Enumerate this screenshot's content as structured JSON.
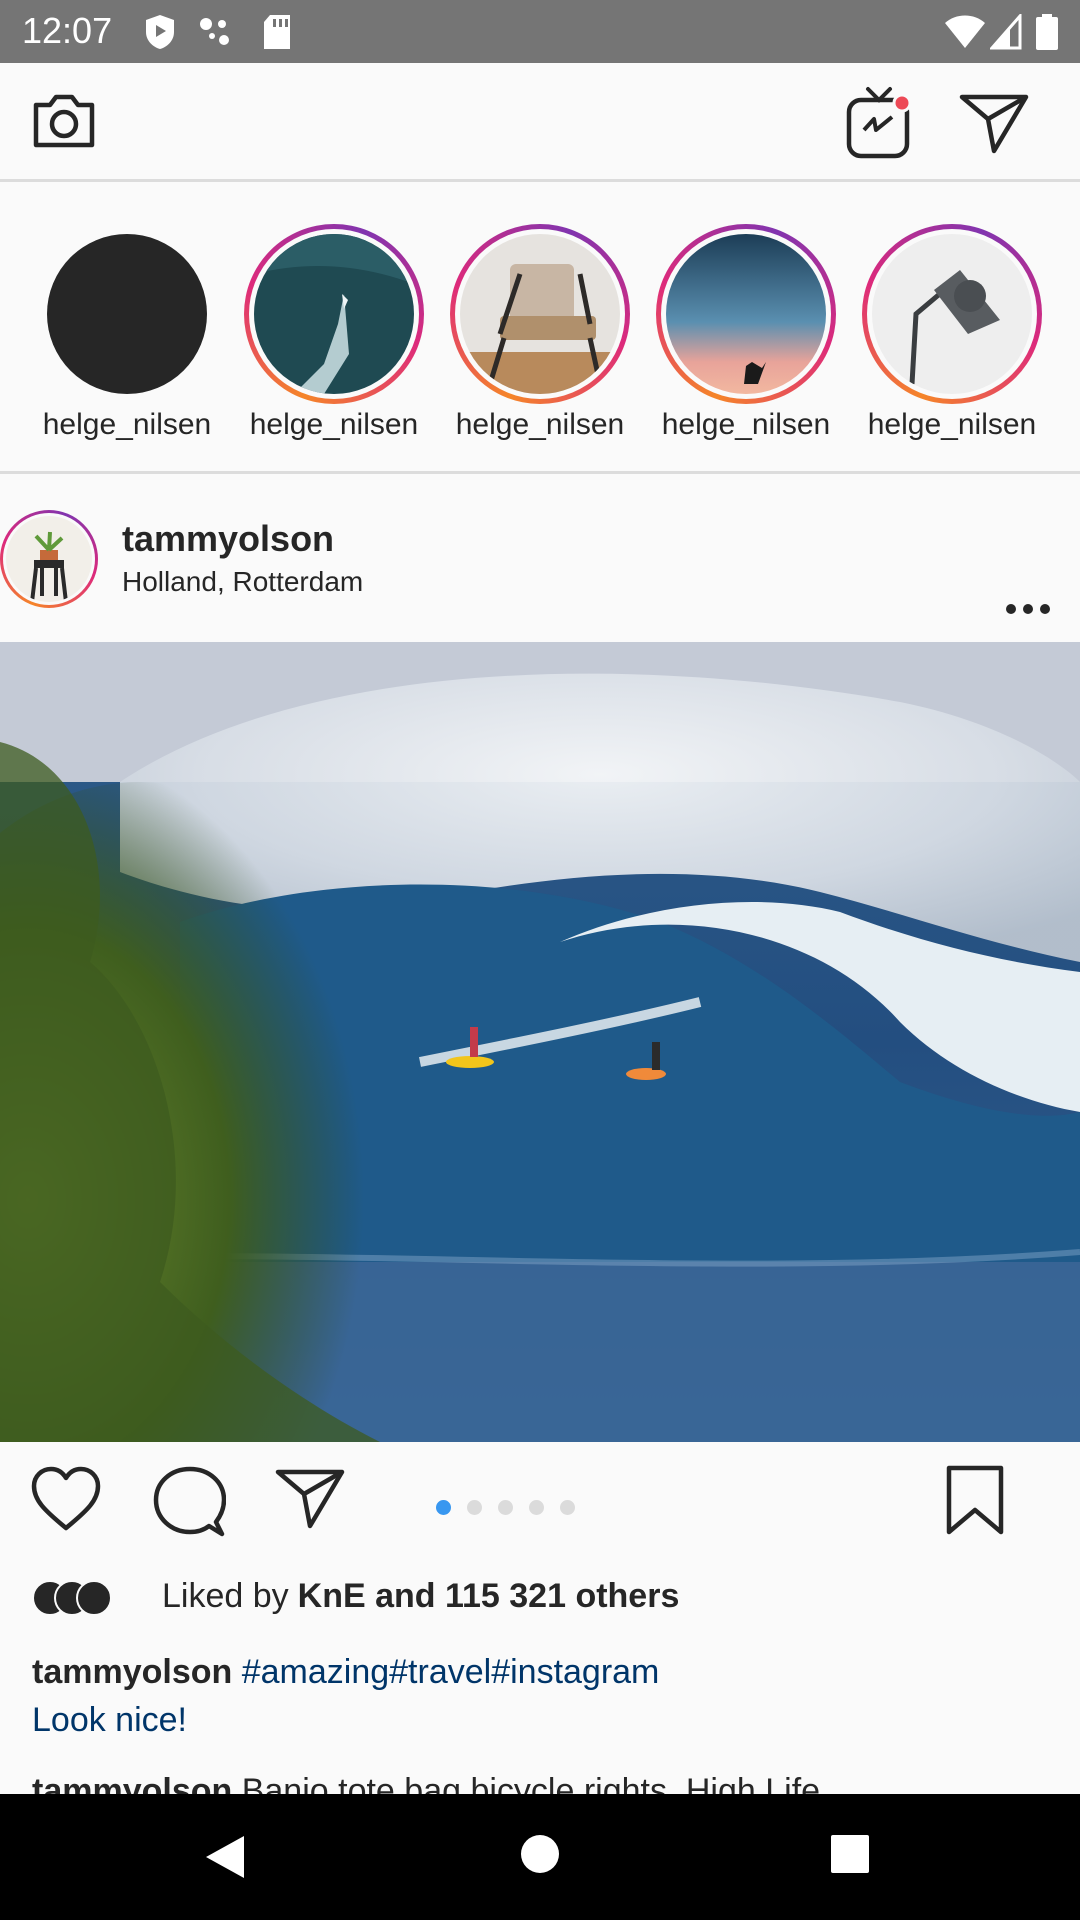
{
  "status_bar": {
    "time": "12:07",
    "icons": [
      "shield-icon",
      "dots-icon",
      "sdcard-icon",
      "wifi-icon",
      "signal-icon",
      "battery-icon"
    ]
  },
  "top_bar": {
    "icons": [
      "camera-icon",
      "igtv-icon",
      "direct-message-icon"
    ],
    "igtv_badge_color": "#ed4956"
  },
  "stories": [
    {
      "username": "helge_nilsen",
      "image": "dark-circle",
      "has_ring": false
    },
    {
      "username": "helge_nilsen",
      "image": "ocean-boat",
      "has_ring": true
    },
    {
      "username": "helge_nilsen",
      "image": "chair",
      "has_ring": true
    },
    {
      "username": "helge_nilsen",
      "image": "sunset-sky",
      "has_ring": true
    },
    {
      "username": "helge_nilsen",
      "image": "desk-lamp",
      "has_ring": true
    }
  ],
  "post": {
    "username": "tammyolson",
    "location": "Holland, Rotterdam",
    "image": "surfers-on-wave",
    "carousel": {
      "count": 5,
      "active_index": 0
    },
    "likes": {
      "prefix": "Liked by ",
      "bold_text": "KnE and 115 321 others"
    },
    "caption": {
      "username": "tammyolson",
      "hashtags": "#amazing#travel#instagram",
      "more": "Look nice!"
    },
    "comment_preview": {
      "username": "tammyolson",
      "text": "Banjo tote bag bicycle rights, High Life"
    }
  },
  "colors": {
    "accent_blue": "#3897f0",
    "hashtag_blue": "#003569",
    "story_ring": [
      "#f58529",
      "#dd2a7b",
      "#8134af"
    ]
  },
  "nav_bar": {
    "buttons": [
      "back-icon",
      "home-icon",
      "recents-icon"
    ]
  }
}
